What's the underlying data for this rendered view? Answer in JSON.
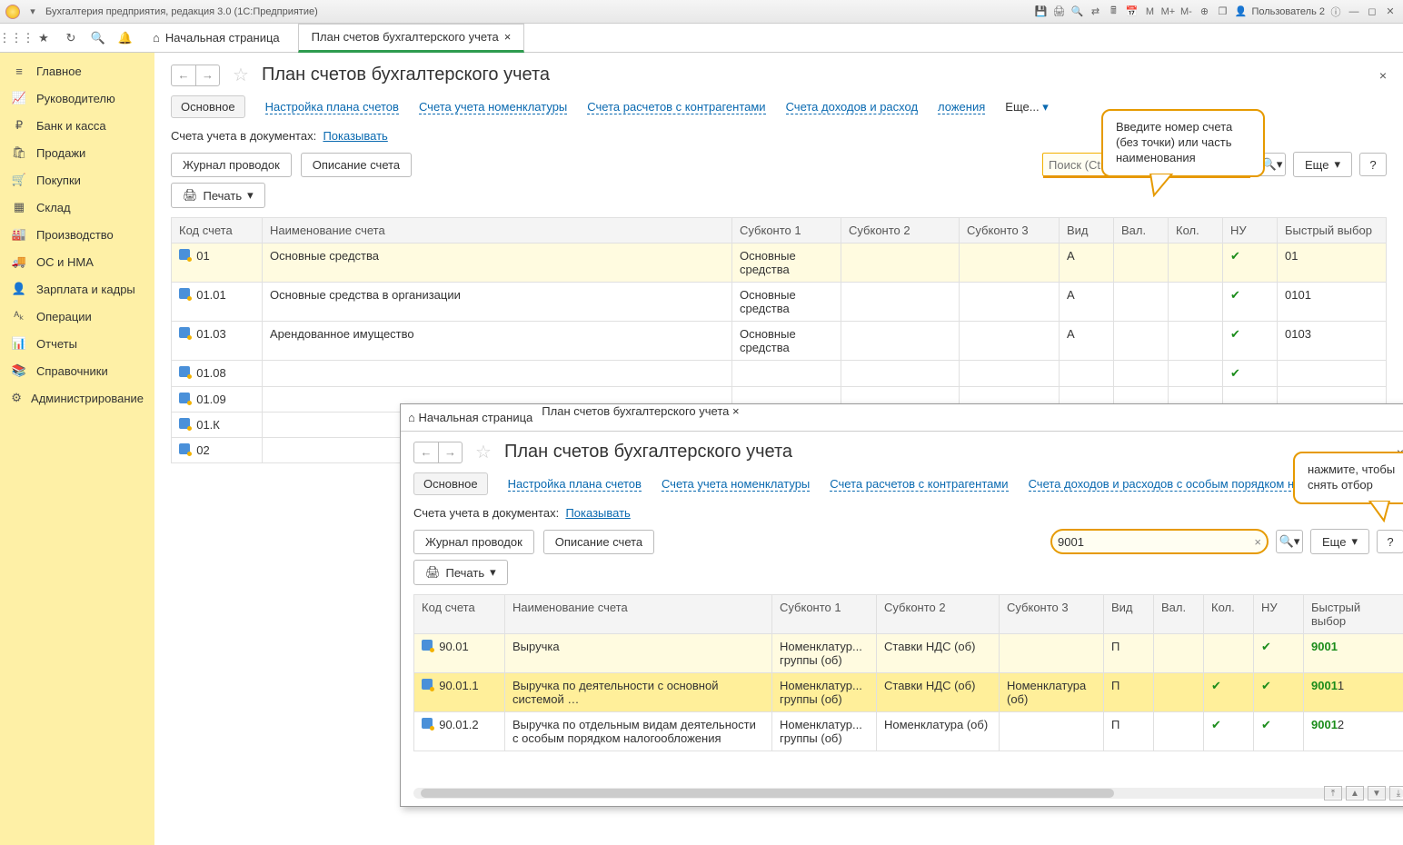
{
  "titlebar": {
    "title": "Бухгалтерия предприятия, редакция 3.0  (1С:Предприятие)",
    "user": "Пользователь 2",
    "menuletters": [
      "М",
      "М+",
      "М-"
    ]
  },
  "toolbar": {
    "home": "Начальная страница",
    "tab_label": "План счетов бухгалтерского учета"
  },
  "sidebar": {
    "items": [
      {
        "icon": "≡",
        "label": "Главное"
      },
      {
        "icon": "📈",
        "label": "Руководителю"
      },
      {
        "icon": "₽",
        "label": "Банк и касса"
      },
      {
        "icon": "🛍",
        "label": "Продажи"
      },
      {
        "icon": "🛒",
        "label": "Покупки"
      },
      {
        "icon": "▦",
        "label": "Склад"
      },
      {
        "icon": "🏭",
        "label": "Производство"
      },
      {
        "icon": "🚚",
        "label": "ОС и НМА"
      },
      {
        "icon": "👤",
        "label": "Зарплата и кадры"
      },
      {
        "icon": "ᴬₖ",
        "label": "Операции"
      },
      {
        "icon": "📊",
        "label": "Отчеты"
      },
      {
        "icon": "📚",
        "label": "Справочники"
      },
      {
        "icon": "⚙",
        "label": "Администрирование"
      }
    ]
  },
  "page": {
    "title": "План счетов бухгалтерского учета",
    "links": {
      "main": "Основное",
      "l1": "Настройка плана счетов",
      "l2": "Счета учета номенклатуры",
      "l3": "Счета расчетов с контрагентами",
      "l4": "Счета доходов и расход",
      "l4b": "Счета доходов и расходов с особым порядком налог",
      "l5": "ложения",
      "more": "Еще..."
    },
    "doc_label": "Счета учета в документах:",
    "doc_link": "Показывать",
    "btn_journal": "Журнал проводок",
    "btn_desc": "Описание счета",
    "btn_print": "Печать",
    "btn_more": "Еще",
    "search_placeholder": "Поиск (Ctrl+F)",
    "search_value": "9001",
    "callout1": "Введите номер счета (без точки) или часть наименования",
    "callout2": "нажмите, чтобы снять отбор",
    "columns": {
      "code": "Код счета",
      "name": "Наименование счета",
      "s1": "Субконто 1",
      "s2": "Субконто 2",
      "s3": "Субконто 3",
      "vid": "Вид",
      "val": "Вал.",
      "kol": "Кол.",
      "nu": "НУ",
      "fast": "Быстрый выбор"
    },
    "rows": [
      {
        "code": "01",
        "name": "Основные средства",
        "s1": "Основные средства",
        "vid": "А",
        "nu": true,
        "fast": "01",
        "sel": true
      },
      {
        "code": "01.01",
        "name": "Основные средства в организации",
        "s1": "Основные средства",
        "vid": "А",
        "nu": true,
        "fast": "0101"
      },
      {
        "code": "01.03",
        "name": "Арендованное имущество",
        "s1": "Основные средства",
        "vid": "А",
        "nu": true,
        "fast": "0103"
      },
      {
        "code": "01.08",
        "name": "",
        "s1": "",
        "vid": "",
        "nu": true,
        "fast": ""
      },
      {
        "code": "01.09",
        "name": "",
        "s1": "",
        "vid": "",
        "nu": false,
        "fast": ""
      },
      {
        "code": "01.К",
        "name": "",
        "s1": "",
        "vid": "",
        "nu": false,
        "fast": ""
      },
      {
        "code": "02",
        "name": "",
        "s1": "",
        "vid": "",
        "nu": false,
        "fast": ""
      }
    ],
    "rows2": [
      {
        "code": "90.01",
        "name": "Выручка",
        "s1": "Номенклатур... группы (об)",
        "s2": "Ставки НДС (об)",
        "s3": "",
        "vid": "П",
        "kol": false,
        "nu": true,
        "fast": "9001",
        "hl": "9001",
        "sel": true
      },
      {
        "code": "90.01.1",
        "name": "Выручка по деятельности с основной системой …",
        "s1": "Номенклатур... группы (об)",
        "s2": "Ставки НДС (об)",
        "s3": "Номенклатура (об)",
        "vid": "П",
        "kol": true,
        "nu": true,
        "fast": "90011",
        "hl": "9001",
        "sel2": true
      },
      {
        "code": "90.01.2",
        "name": "Выручка по отдельным видам деятельности с особым порядком налогообложения",
        "s1": "Номенклатур... группы (об)",
        "s2": "Номенклатура (об)",
        "s3": "",
        "vid": "П",
        "kol": true,
        "nu": true,
        "fast": "90012",
        "hl": "9001"
      }
    ]
  }
}
